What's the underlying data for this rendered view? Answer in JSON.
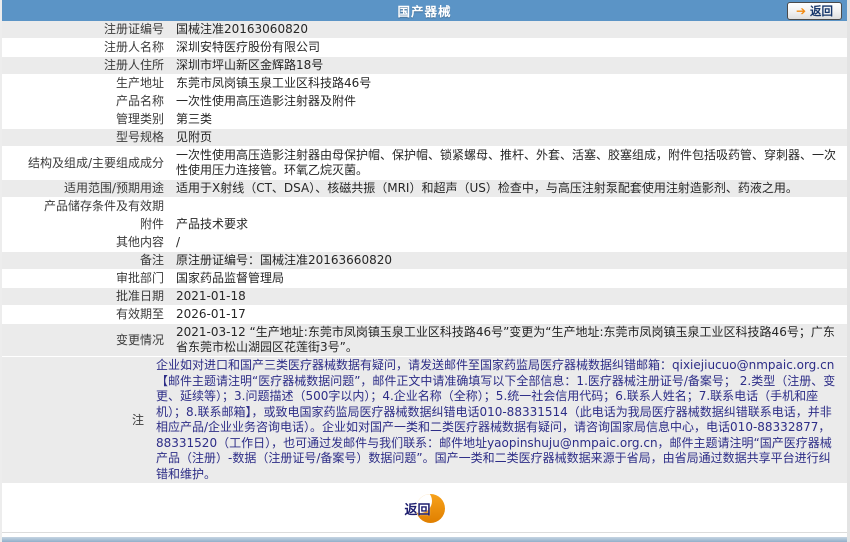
{
  "header": {
    "title": "国产器械",
    "back_label": "返回",
    "back_icon": "arrow-right-icon"
  },
  "rows": [
    {
      "label": "注册证编号",
      "value": "国械注准20163060820"
    },
    {
      "label": "注册人名称",
      "value": "深圳安特医疗股份有限公司"
    },
    {
      "label": "注册人住所",
      "value": "深圳市坪山新区金辉路18号"
    },
    {
      "label": "生产地址",
      "value": "东莞市凤岗镇玉泉工业区科技路46号"
    },
    {
      "label": "产品名称",
      "value": "一次性使用高压造影注射器及附件"
    },
    {
      "label": "管理类别",
      "value": "第三类"
    },
    {
      "label": "型号规格",
      "value": "见附页"
    },
    {
      "label": "结构及组成/主要组成成分",
      "value": "一次性使用高压造影注射器由母保护帽、保护帽、锁紧螺母、推杆、外套、活塞、胶塞组成，附件包括吸药管、穿刺器、一次性使用压力连接管。环氧乙烷灭菌。"
    },
    {
      "label": "适用范围/预期用途",
      "value": "适用于X射线（CT、DSA）、核磁共振（MRI）和超声（US）检查中，与高压注射泵配套使用注射造影剂、药液之用。"
    },
    {
      "label": "产品储存条件及有效期",
      "value": ""
    },
    {
      "label": "附件",
      "value": "产品技术要求"
    },
    {
      "label": "其他内容",
      "value": "/"
    },
    {
      "label": "备注",
      "value": "原注册证编号：国械注准20163660820"
    },
    {
      "label": "审批部门",
      "value": "国家药品监督管理局"
    },
    {
      "label": "批准日期",
      "value": "2021-01-18"
    },
    {
      "label": "有效期至",
      "value": "2026-01-17"
    },
    {
      "label": "变更情况",
      "value": "2021-03-12 “生产地址:东莞市凤岗镇玉泉工业区科技路46号”变更为“生产地址:东莞市凤岗镇玉泉工业区科技路46号；广东省东莞市松山湖园区花莲街3号”。"
    },
    {
      "label": "注",
      "value": "企业如对进口和国产三类医疗器械数据有疑问，请发送邮件至国家药监局医疗器械数据纠错邮箱：qixiejiucuo@nmpaic.org.cn【邮件主题请注明“医疗器械数据问题”，邮件正文中请准确填写以下全部信息：1.医疗器械注册证号/备案号； 2.类型（注册、变更、延续等）；3.问题描述（500字以内）；4.企业名称（全称）；5.统一社会信用代码；6.联系人姓名；7.联系电话（手机和座机）；8.联系邮箱】，或致电国家药监局医疗器械数据纠错电话010-88331514（此电话为我局医疗器械数据纠错联系电话，并非相应产品/企业业务咨询电话）。企业如对国产一类和二类医疗器械数据有疑问，请咨询国家局信息中心，电话010-88332877，88331520（工作日），也可通过发邮件与我们联系：邮件地址yaopinshuju@nmpaic.org.cn，邮件主题请注明“国产医疗器械产品（注册）-数据（注册证号/备案号）数据问题”。国产一类和二类医疗器械数据来源于省局，由省局通过数据共享平台进行纠错和维护。"
    }
  ],
  "footer": {
    "back_label": "返回",
    "back_icon": "crescent-icon"
  },
  "colors": {
    "header_bg": "#5B94C6",
    "row_alt_bg": "#EBEBEB",
    "note_text": "#2D2D87",
    "accent_orange": "#F0920E",
    "back_text": "#17376B"
  }
}
